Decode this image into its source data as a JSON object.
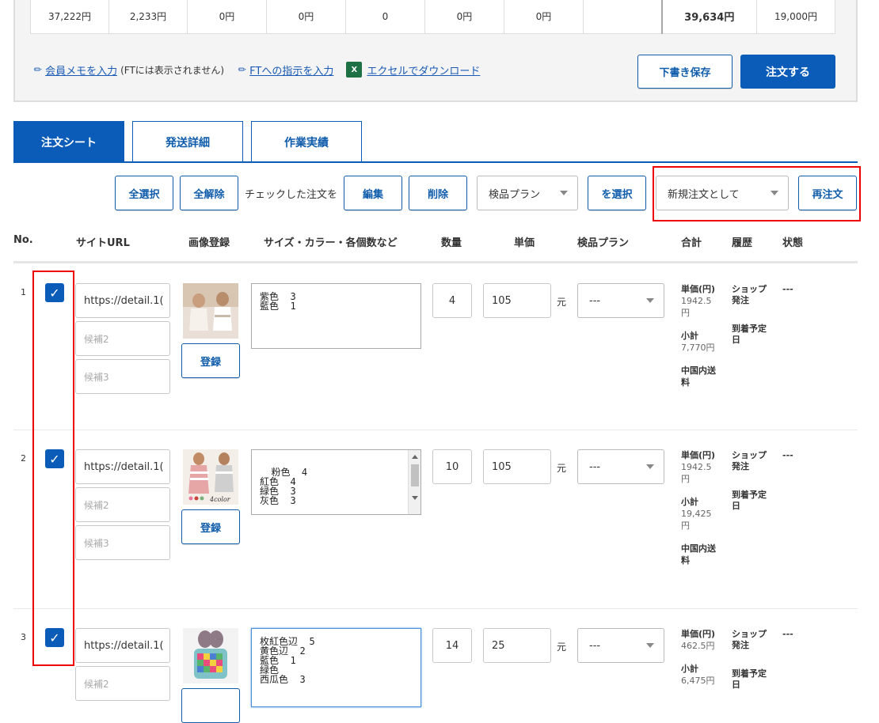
{
  "totals": {
    "cells": [
      "37,222円",
      "2,233円",
      "0円",
      "0円",
      "0",
      "0円",
      "0円",
      "",
      "39,634円",
      "19,000円"
    ]
  },
  "links": {
    "member_memo": "会員メモを入力",
    "member_memo_note": "(FTには表示されません)",
    "ft_instruction": "FTへの指示を入力",
    "excel_download": "エクセルでダウンロード"
  },
  "actions": {
    "save_draft": "下書き保存",
    "order": "注文する"
  },
  "tabs": [
    "注文シート",
    "発送詳細",
    "作業実績"
  ],
  "toolbar": {
    "select_all": "全選択",
    "deselect_all": "全解除",
    "checked_text": "チェックした注文を",
    "edit": "編集",
    "delete": "削除",
    "inspection_plan_value": "検品プラン",
    "select_suffix": "を選択",
    "reorder_mode_value": "新規注文として",
    "reorder": "再注文"
  },
  "headers": {
    "no": "No.",
    "site_url": "サイトURL",
    "image": "画像登録",
    "details": "サイズ・カラー・各個数など",
    "qty": "数量",
    "unit_price": "単価",
    "plan": "検品プラン",
    "total": "合計",
    "history": "履歴",
    "status": "状態"
  },
  "rows": [
    {
      "no": "1",
      "url": "https://detail.1(",
      "cand2": "候補2",
      "cand3": "候補3",
      "register": "登録",
      "details": "紫色  3\n藍色  1",
      "qty": "4",
      "price": "105",
      "yuan": "元",
      "plan": "---",
      "unit_label": "単価(円)",
      "unit_val": "1942.5\n円",
      "sub_label": "小計",
      "sub_val": "7,770円",
      "ship_label": "中国内送\n料",
      "hist1": "ショップ\n発注",
      "hist2": "到着予定\n日",
      "status": "---"
    },
    {
      "no": "2",
      "url": "https://detail.1(",
      "cand2": "候補2",
      "cand3": "候補3",
      "register": "登録",
      "details": "粉色  4\n紅色  4\n緑色  3\n灰色  3",
      "qty": "10",
      "price": "105",
      "yuan": "元",
      "plan": "---",
      "unit_label": "単価(円)",
      "unit_val": "1942.5\n円",
      "sub_label": "小計",
      "sub_val": "19,425\n円",
      "ship_label": "中国内送\n料",
      "hist1": "ショップ\n発注",
      "hist2": "到着予定\n日",
      "status": "---"
    },
    {
      "no": "3",
      "url": "https://detail.1(",
      "cand2": "候補2",
      "cand3": "",
      "register": "",
      "details": "枚紅色辺  5\n黄色辺  2\n藍色  1\n緑色\n西瓜色  3",
      "qty": "14",
      "price": "25",
      "yuan": "元",
      "plan": "---",
      "unit_label": "単価(円)",
      "unit_val": "462.5円",
      "sub_label": "小計",
      "sub_val": "6,475円",
      "ship_label": "",
      "hist1": "ショップ\n発注",
      "hist2": "到着予定\n日",
      "status": "---"
    }
  ],
  "colors": {
    "primary": "#0a5cb8",
    "highlight": "#e00000"
  }
}
